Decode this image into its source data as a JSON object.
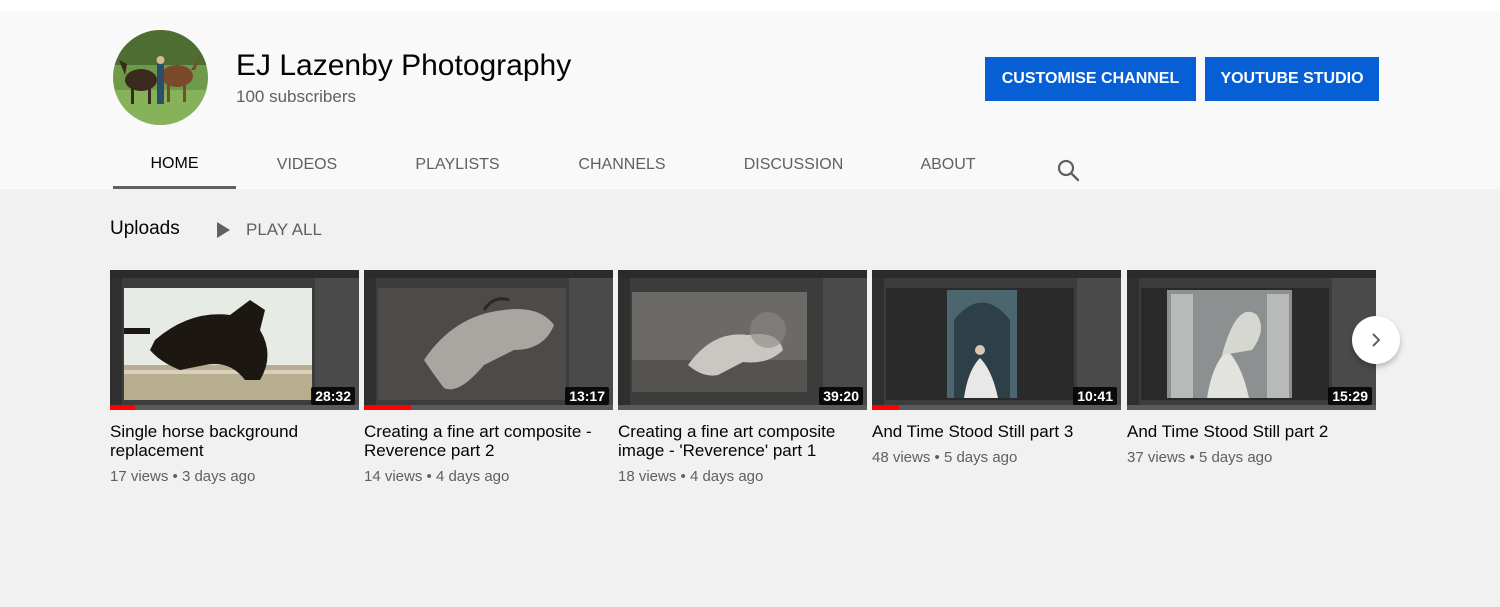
{
  "channel": {
    "name": "EJ Lazenby Photography",
    "subscribers": "100 subscribers"
  },
  "actions": {
    "customise": "CUSTOMISE CHANNEL",
    "studio": "YOUTUBE STUDIO"
  },
  "tabs": [
    {
      "label": "HOME",
      "active": true
    },
    {
      "label": "VIDEOS",
      "active": false
    },
    {
      "label": "PLAYLISTS",
      "active": false
    },
    {
      "label": "CHANNELS",
      "active": false
    },
    {
      "label": "DISCUSSION",
      "active": false
    },
    {
      "label": "ABOUT",
      "active": false
    }
  ],
  "icons": {
    "search": "search-icon",
    "play": "play-icon",
    "next": "chevron-right-icon"
  },
  "colors": {
    "primary_button": "#065fd4",
    "progress": "#ff0000",
    "secondary_text": "#606060"
  },
  "uploads": {
    "title": "Uploads",
    "play_all": "PLAY ALL"
  },
  "videos": [
    {
      "title": "Single horse background replacement",
      "duration": "28:32",
      "views": "17 views",
      "age": "3 days ago",
      "watched_fraction": 0.1
    },
    {
      "title": "Creating a fine art composite - Reverence part 2",
      "duration": "13:17",
      "views": "14 views",
      "age": "4 days ago",
      "watched_fraction": 0.19
    },
    {
      "title": "Creating a fine art composite image - 'Reverence' part 1",
      "duration": "39:20",
      "views": "18 views",
      "age": "4 days ago",
      "watched_fraction": 0
    },
    {
      "title": "And Time Stood Still part 3",
      "duration": "10:41",
      "views": "48 views",
      "age": "5 days ago",
      "watched_fraction": 0.11
    },
    {
      "title": "And Time Stood Still part 2",
      "duration": "15:29",
      "views": "37 views",
      "age": "5 days ago",
      "watched_fraction": 0
    }
  ]
}
